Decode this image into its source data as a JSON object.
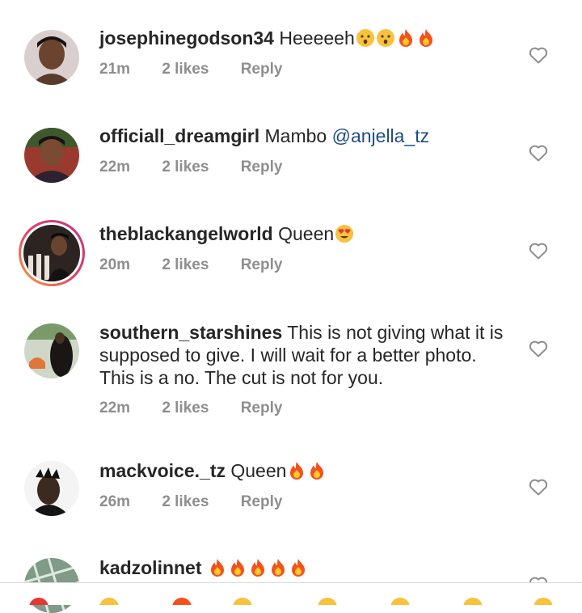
{
  "comments": [
    {
      "username": "josephinegodson34",
      "text": "Heeeeeh",
      "emojis": [
        "hushed-face",
        "hushed-face",
        "fire",
        "fire"
      ],
      "time": "21m",
      "likes": "2 likes",
      "reply": "Reply"
    },
    {
      "username": "officiall_dreamgirl",
      "text": "Mambo ",
      "mention": "@anjella_tz",
      "emojis": [],
      "time": "22m",
      "likes": "2 likes",
      "reply": "Reply"
    },
    {
      "username": "theblackangelworld",
      "text": "Queen",
      "emojis": [
        "heart-eyes"
      ],
      "time": "20m",
      "likes": "2 likes",
      "reply": "Reply"
    },
    {
      "username": "southern_starshines",
      "text": "This is not giving what it is supposed to give. I will wait for a better photo. This is a no. The cut is not for you.",
      "emojis": [],
      "time": "22m",
      "likes": "2 likes",
      "reply": "Reply"
    },
    {
      "username": "mackvoice._tz",
      "text": "Queen",
      "emojis": [
        "fire",
        "fire"
      ],
      "time": "26m",
      "likes": "2 likes",
      "reply": "Reply"
    },
    {
      "username": "kadzolinnet",
      "text": "",
      "emojis": [
        "fire",
        "fire",
        "fire",
        "fire",
        "fire"
      ]
    }
  ],
  "colors": {
    "mention": "#1f4b8e",
    "meta": "#8e8e8e",
    "text": "#262626"
  },
  "icons": {
    "like": "heart-outline-icon"
  }
}
